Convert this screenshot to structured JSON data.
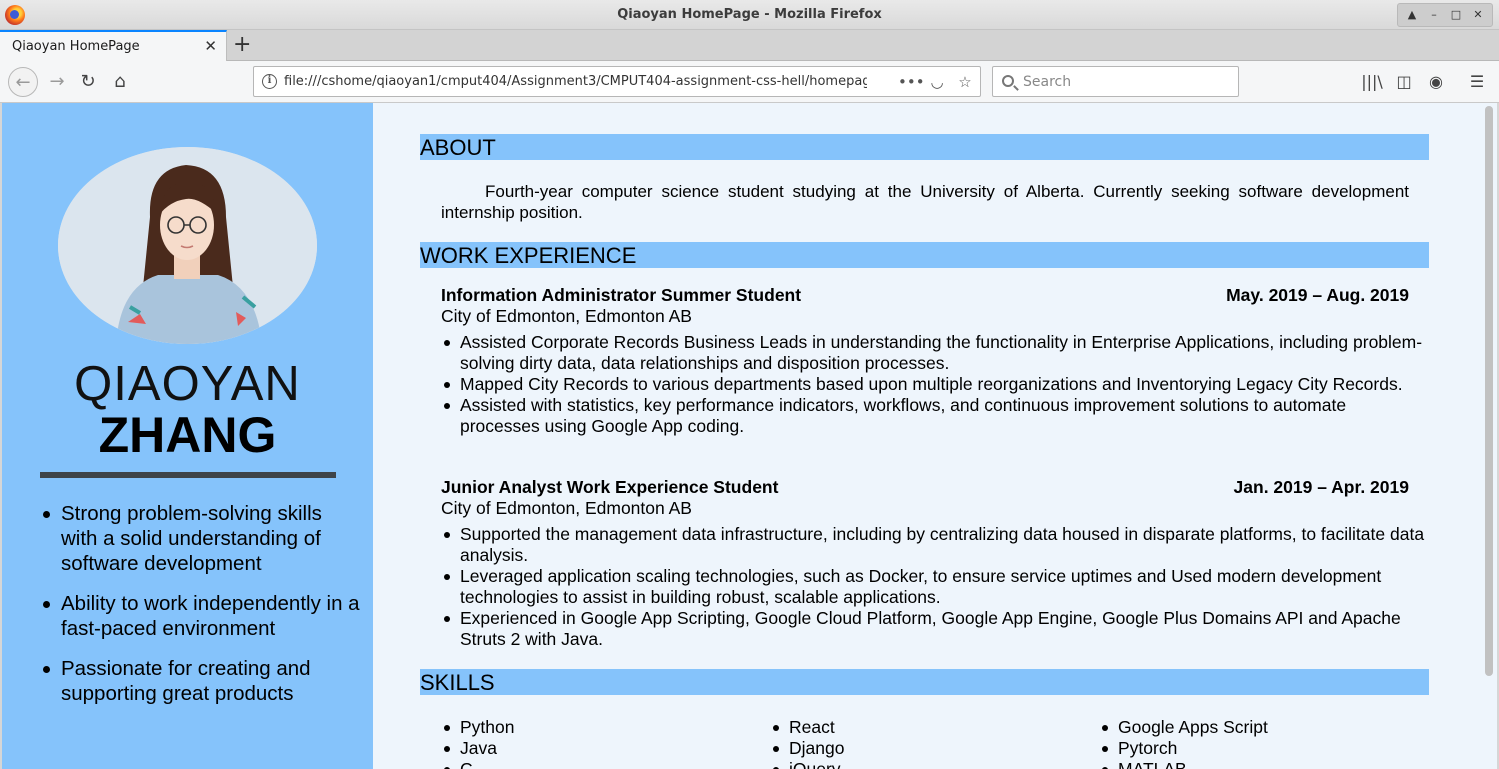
{
  "window": {
    "title": "Qiaoyan HomePage - Mozilla Firefox"
  },
  "tab": {
    "title": "Qiaoyan HomePage"
  },
  "urlbar": {
    "url": "file:///cshome/qiaoyan1/cmput404/Assignment3/CMPUT404-assignment-css-hell/homepage"
  },
  "search": {
    "placeholder": "Search"
  },
  "profile": {
    "first_name": "QIAOYAN",
    "last_name": "ZHANG",
    "highlights": [
      "Strong problem-solving skills with a solid understanding of software development",
      "Ability to work independently in a fast-paced environment",
      "Passionate for creating and supporting great products"
    ]
  },
  "about": {
    "heading": "ABOUT",
    "text": "Fourth-year computer science student studying at the University of Alberta. Currently seeking software development internship position."
  },
  "work": {
    "heading": "WORK EXPERIENCE",
    "jobs": [
      {
        "title": "Information Administrator Summer Student",
        "dates": "May. 2019 – Aug. 2019",
        "org": "City of Edmonton, Edmonton AB",
        "bullets": [
          "Assisted Corporate Records Business Leads in understanding the functionality in Enterprise Applications, including problem-solving dirty data, data relationships and disposition processes.",
          "Mapped City Records to various departments based upon multiple reorganizations and Inventorying Legacy City Records.",
          "Assisted with statistics, key performance indicators, workflows, and continuous improvement solutions to automate processes using Google App coding."
        ]
      },
      {
        "title": "Junior Analyst Work Experience Student",
        "dates": "Jan. 2019 – Apr. 2019",
        "org": "City of Edmonton, Edmonton AB",
        "bullets": [
          "Supported the management data infrastructure, including by centralizing data housed in disparate platforms, to facilitate data analysis.",
          "Leveraged application scaling technologies, such as Docker, to ensure service uptimes and Used modern development technologies to assist in building robust, scalable applications.",
          "Experienced in Google App Scripting, Google Cloud Platform, Google App Engine, Google Plus Domains API and Apache Struts 2 with Java."
        ]
      }
    ]
  },
  "skills": {
    "heading": "SKILLS",
    "col1": [
      "Python",
      "Java",
      "C"
    ],
    "col2": [
      "React",
      "Django",
      "jQuery"
    ],
    "col3": [
      "Google Apps Script",
      "Pytorch",
      "MATLAB"
    ]
  }
}
